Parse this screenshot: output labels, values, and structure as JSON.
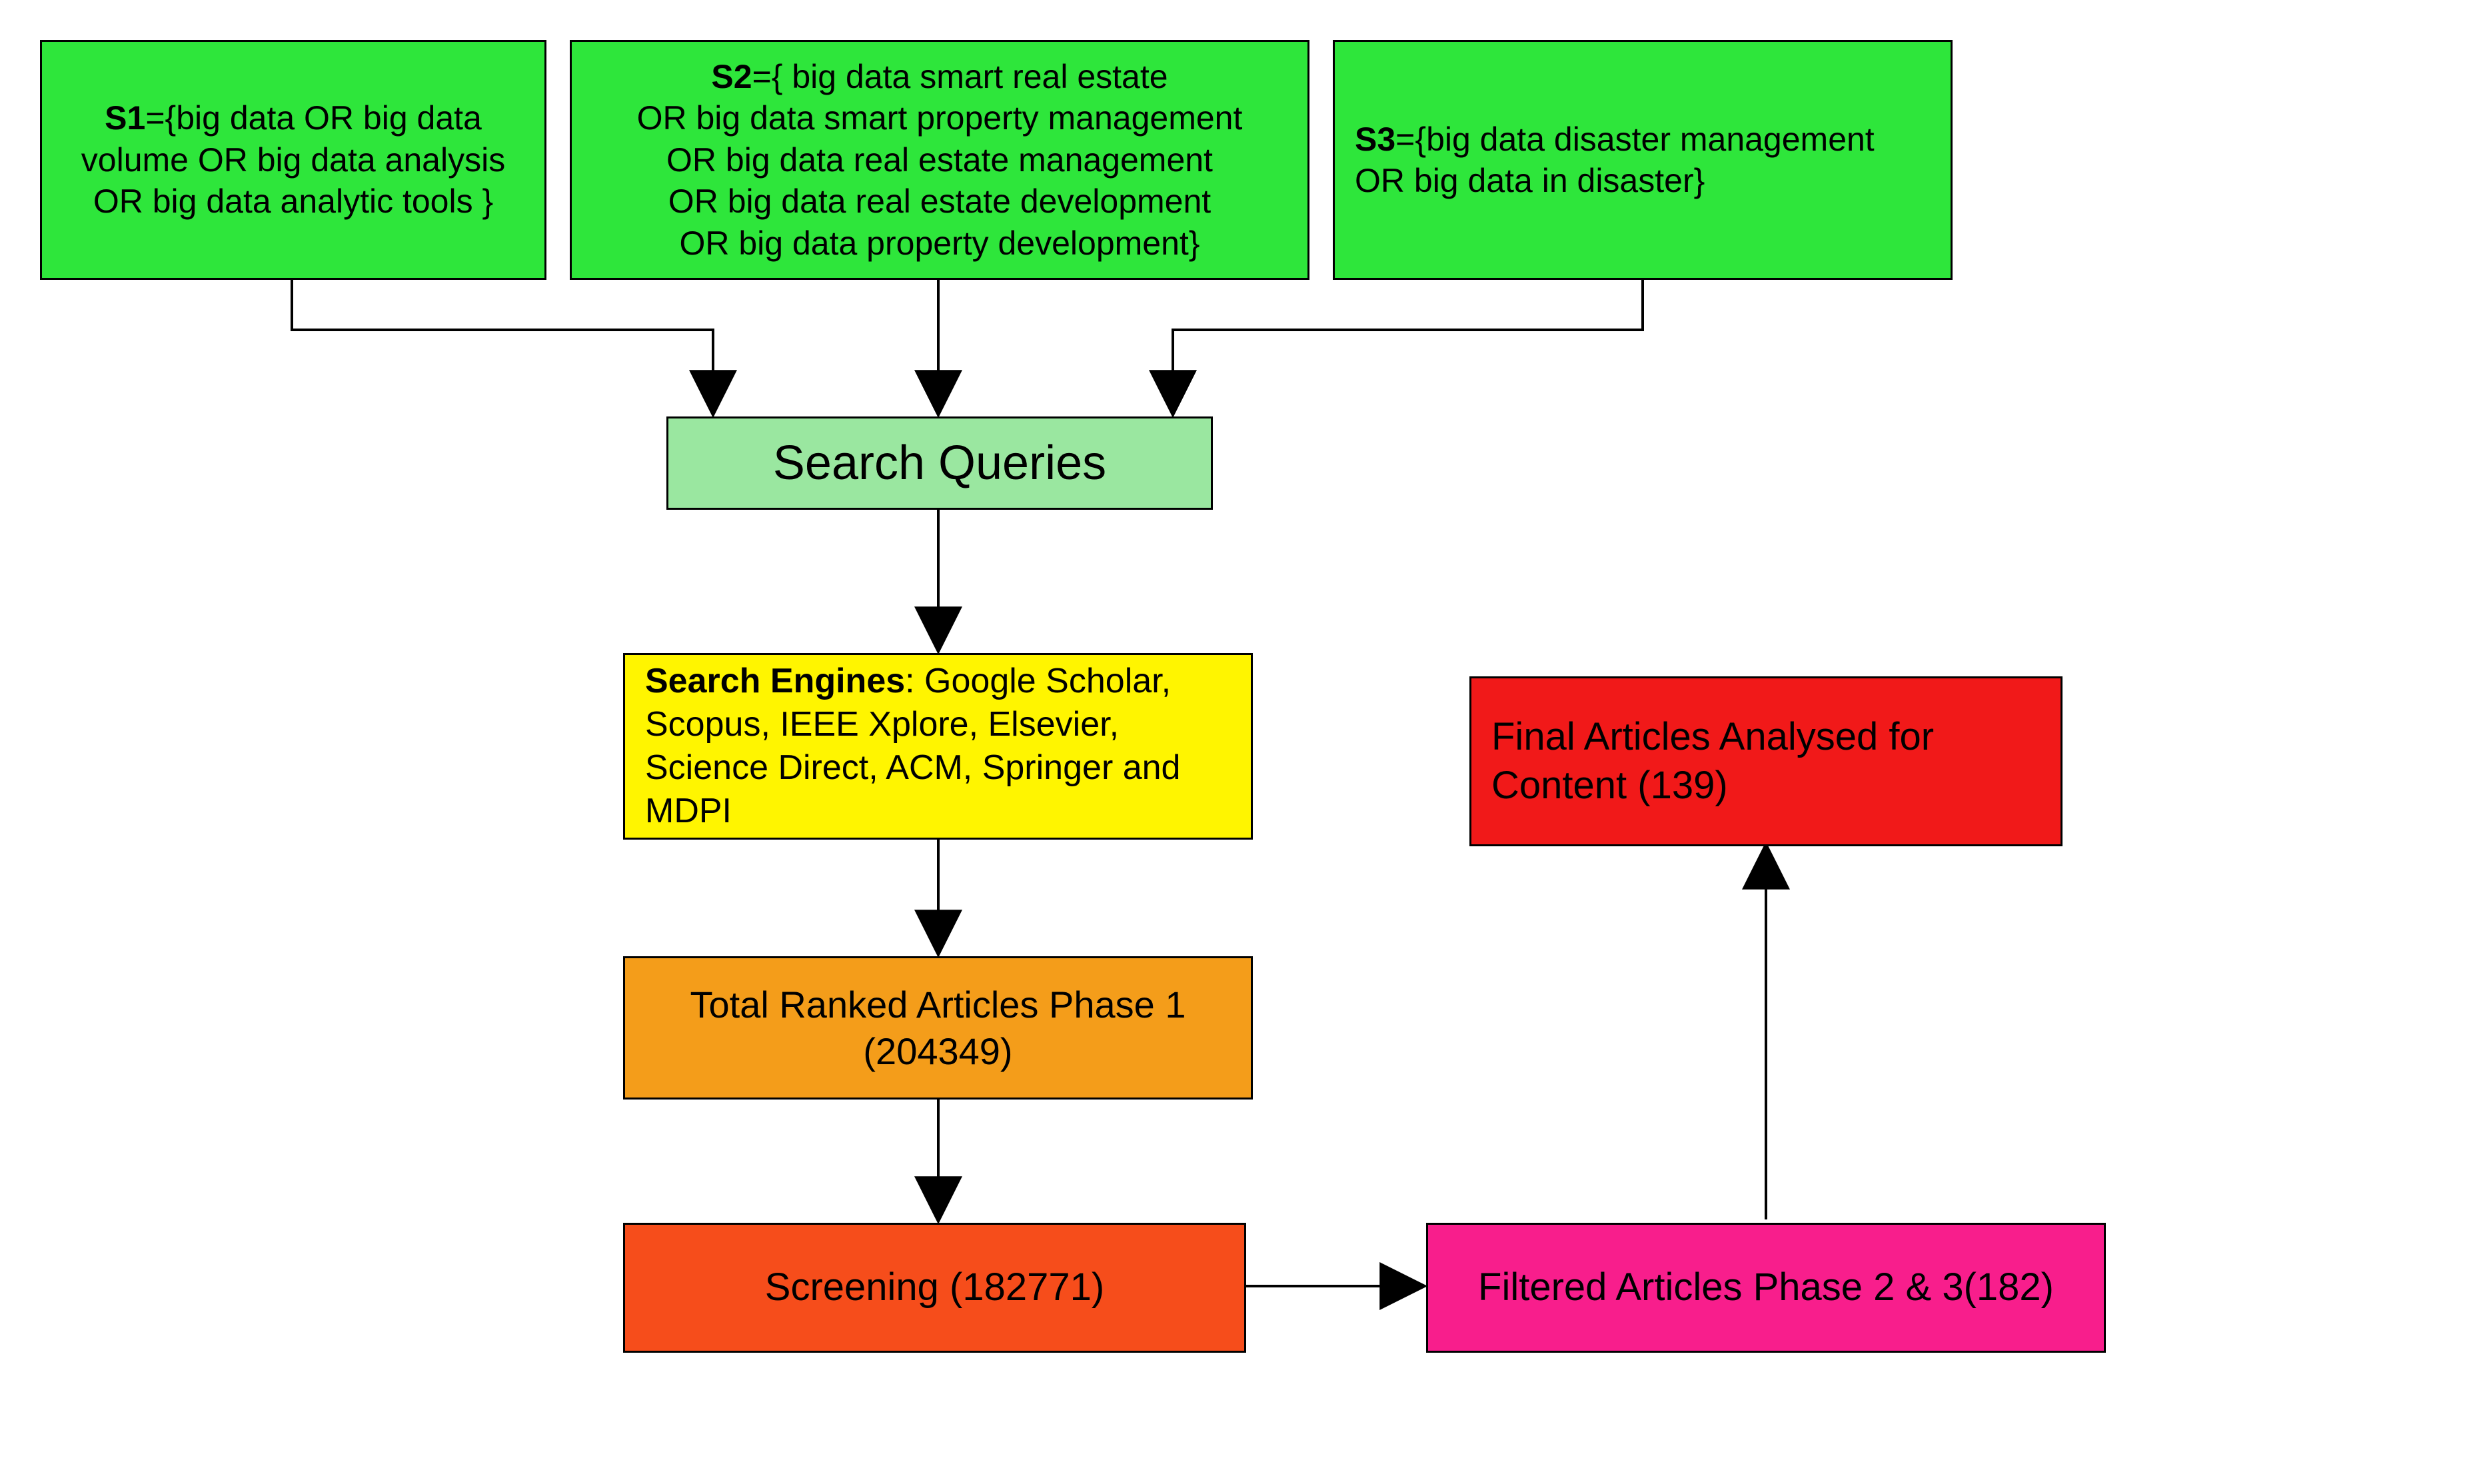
{
  "s1": {
    "prefix": "S1",
    "text": "={big data OR big data volume OR big data analysis OR big data analytic tools }"
  },
  "s2": {
    "prefix": "S2",
    "lines": [
      "={ big data smart real estate",
      "OR big data smart property management",
      "OR big data real estate management",
      "OR  big data real estate development",
      "OR big data property development}"
    ]
  },
  "s3": {
    "prefix": "S3",
    "lines": [
      "={big data disaster management",
      " OR big data in disaster}"
    ]
  },
  "search_queries": "Search Queries",
  "search_engines": {
    "prefix": "Search Engines",
    "rest": ": Google Scholar, Scopus, IEEE Xplore, Elsevier, Science Direct, ACM, Springer and MDPI"
  },
  "phase1": "Total Ranked Articles Phase 1 (204349)",
  "screening": "Screening (182771)",
  "filtered": "Filtered Articles Phase 2 & 3(182)",
  "final": "Final Articles Analysed for Content (139)",
  "chart_data": {
    "type": "table",
    "title": "Literature search & screening flow",
    "nodes": [
      {
        "id": "S1",
        "label": "S1 query: big data / volume / analysis / analytic tools"
      },
      {
        "id": "S2",
        "label": "S2 query: big data + smart real estate / property management / real estate management / real estate development / property development"
      },
      {
        "id": "S3",
        "label": "S3 query: big data disaster management / big data in disaster"
      },
      {
        "id": "SQ",
        "label": "Search Queries"
      },
      {
        "id": "SE",
        "label": "Search Engines: Google Scholar, Scopus, IEEE Xplore, Elsevier, Science Direct, ACM, Springer, MDPI"
      },
      {
        "id": "P1",
        "label": "Total Ranked Articles Phase 1",
        "value": 204349
      },
      {
        "id": "SC",
        "label": "Screening",
        "value": 182771
      },
      {
        "id": "F23",
        "label": "Filtered Articles Phase 2 & 3",
        "value": 182
      },
      {
        "id": "FIN",
        "label": "Final Articles Analysed for Content",
        "value": 139
      }
    ],
    "edges": [
      [
        "S1",
        "SQ"
      ],
      [
        "S2",
        "SQ"
      ],
      [
        "S3",
        "SQ"
      ],
      [
        "SQ",
        "SE"
      ],
      [
        "SE",
        "P1"
      ],
      [
        "P1",
        "SC"
      ],
      [
        "SC",
        "F23"
      ],
      [
        "F23",
        "FIN"
      ]
    ]
  }
}
